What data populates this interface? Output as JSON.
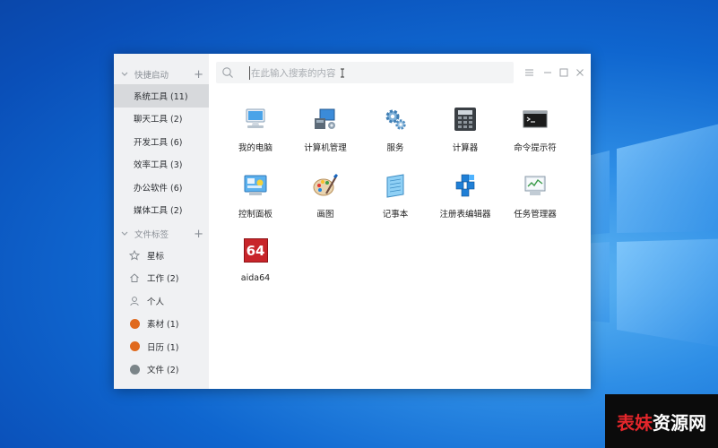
{
  "search": {
    "placeholder": "在此输入搜索的内容"
  },
  "sidebar": {
    "quick_launch": {
      "title": "快捷启动",
      "items": [
        {
          "label": "系统工具 (11)"
        },
        {
          "label": "聊天工具 (2)"
        },
        {
          "label": "开发工具 (6)"
        },
        {
          "label": "效率工具 (3)"
        },
        {
          "label": "办公软件 (6)"
        },
        {
          "label": "媒体工具 (2)"
        }
      ]
    },
    "file_tags": {
      "title": "文件标签",
      "items": [
        {
          "label": "星标",
          "icon": "star-icon"
        },
        {
          "label": "工作 (2)",
          "icon": "home-icon"
        },
        {
          "label": "个人",
          "icon": "person-icon"
        },
        {
          "label": "素材 (1)",
          "icon": "dot",
          "color": "#e06a1e"
        },
        {
          "label": "日历 (1)",
          "icon": "dot",
          "color": "#e06a1e"
        },
        {
          "label": "文件 (2)",
          "icon": "dot",
          "color": "#7b8589"
        }
      ]
    }
  },
  "apps": [
    {
      "label": "我的电脑",
      "icon": "computer-icon"
    },
    {
      "label": "计算机管理",
      "icon": "computer-management-icon"
    },
    {
      "label": "服务",
      "icon": "services-gear-icon"
    },
    {
      "label": "计算器",
      "icon": "calculator-icon"
    },
    {
      "label": "命令提示符",
      "icon": "command-prompt-icon"
    },
    {
      "label": "控制面板",
      "icon": "control-panel-icon"
    },
    {
      "label": "画图",
      "icon": "paint-icon"
    },
    {
      "label": "记事本",
      "icon": "notepad-icon"
    },
    {
      "label": "注册表编辑器",
      "icon": "registry-editor-icon"
    },
    {
      "label": "任务管理器",
      "icon": "task-manager-icon"
    },
    {
      "label": "aida64",
      "icon": "aida64-icon",
      "icon_text": "64"
    }
  ],
  "watermark": {
    "part1": "表妹",
    "part2": "资源网"
  }
}
